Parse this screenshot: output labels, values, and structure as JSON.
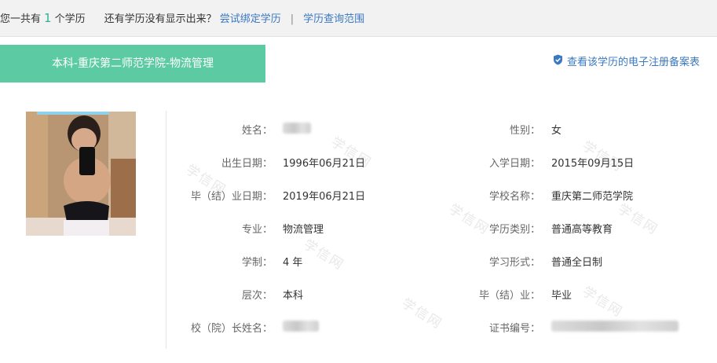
{
  "topbar": {
    "count_prefix": "您一共有",
    "count": "1",
    "count_suffix": "个学历",
    "question": "还有学历没有显示出来？",
    "bind_link": "尝试绑定学历",
    "separator": "|",
    "scope_link": "学历查询范围"
  },
  "record": {
    "title": "本科-重庆第二师范学院-物流管理",
    "cert_link": "查看该学历的电子注册备案表"
  },
  "left_fields": [
    {
      "label": "姓名：",
      "value": ""
    },
    {
      "label": "出生日期：",
      "value": "1996年06月21日"
    },
    {
      "label": "毕（结）业日期：",
      "value": "2019年06月21日"
    },
    {
      "label": "专业：",
      "value": "物流管理"
    },
    {
      "label": "学制：",
      "value": "4 年"
    },
    {
      "label": "层次：",
      "value": "本科"
    },
    {
      "label": "校（院）长姓名：",
      "value": ""
    }
  ],
  "right_fields": [
    {
      "label": "性别：",
      "value": "女"
    },
    {
      "label": "入学日期：",
      "value": "2015年09月15日"
    },
    {
      "label": "学校名称：",
      "value": "重庆第二师范学院"
    },
    {
      "label": "学历类别：",
      "value": "普通高等教育"
    },
    {
      "label": "学习形式：",
      "value": "普通全日制"
    },
    {
      "label": "毕（结）业：",
      "value": "毕业"
    },
    {
      "label": "证书编号：",
      "value": ""
    }
  ],
  "watermark": "学信网",
  "colors": {
    "accent": "#5ccba4",
    "link": "#3a78c2",
    "count": "#2fb38f"
  }
}
